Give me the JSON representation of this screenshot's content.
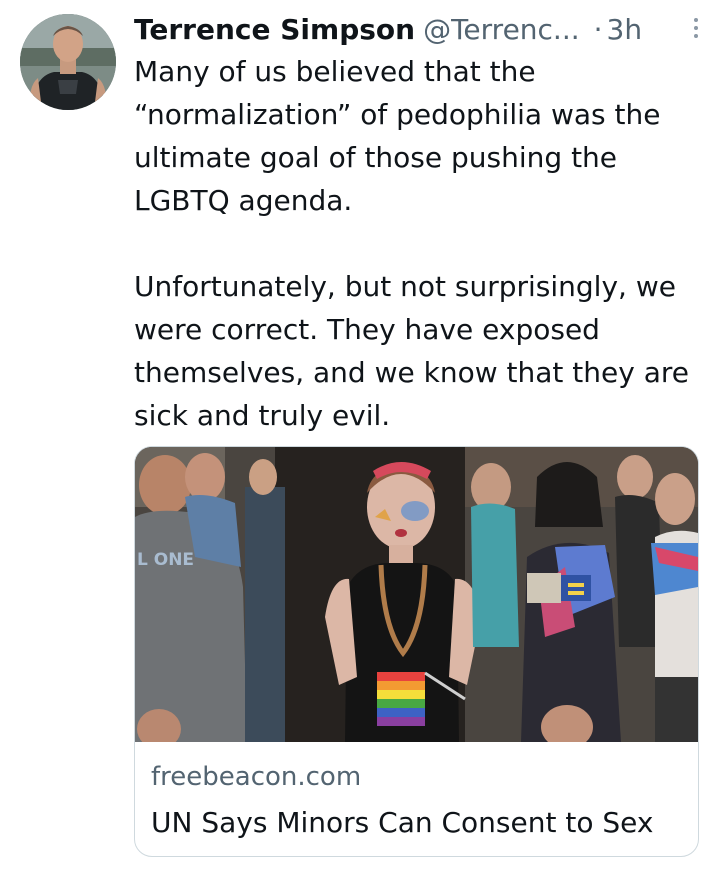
{
  "tweet": {
    "display_name": "Terrence Simpson",
    "handle": "@Terrenc...",
    "separator": "·",
    "time": "3h",
    "text_paragraphs": [
      "Many of us believed that the “normalization” of pedophilia was the ultimate goal of those pushing the LGBTQ agenda.",
      "Unfortunately, but not surprisingly, we were correct. They have exposed themselves, and we know that they are sick and truly evil."
    ],
    "card": {
      "domain": "freebeacon.com",
      "title": "UN Says Minors Can Consent to Sex",
      "sign_text": "L ONE"
    }
  },
  "icons": {
    "more": "more-vertical-icon",
    "avatar": "avatar"
  },
  "colors": {
    "text_primary": "#0f1419",
    "text_secondary": "#536471",
    "card_border": "#cfd9de"
  }
}
